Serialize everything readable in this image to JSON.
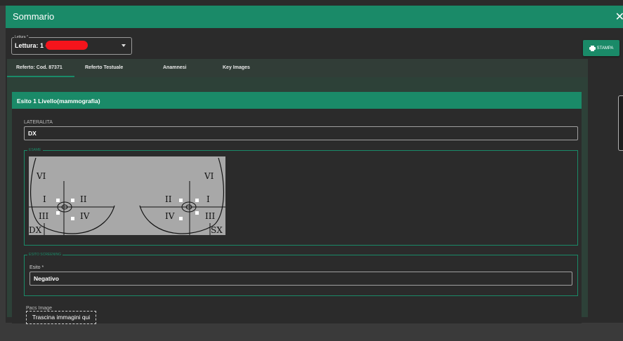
{
  "dialog": {
    "title": "Sommario",
    "close_icon": "close-icon"
  },
  "lettura": {
    "label": "Lettura *",
    "value": "Lettura: 1 -"
  },
  "toolbar": {
    "print_label": "STAMPA"
  },
  "tabs": [
    {
      "label": "Referto: Cod. 87371",
      "active": true
    },
    {
      "label": "Referto Testuale"
    },
    {
      "label": "Anamnesi"
    },
    {
      "label": "Key Images"
    }
  ],
  "card": {
    "title": "Esito 1 Livello(mammografia)",
    "lateralita": {
      "label": "LATERALITA",
      "value": "DX"
    },
    "esame": {
      "legend": "ESAME",
      "diagram": {
        "left": {
          "VI": "VI",
          "I": "I",
          "II": "II",
          "III": "III",
          "IV": "IV",
          "side": "DX"
        },
        "right": {
          "VI": "VI",
          "I": "I",
          "II": "II",
          "III": "III",
          "IV": "IV",
          "side": "SX"
        }
      }
    },
    "esito_screening": {
      "legend": "ESITO SCREENING",
      "label": "Esito *",
      "value": "Negativo"
    },
    "pacs": {
      "label": "Pacs Image",
      "drop_text": "Trascina immagini qui"
    }
  },
  "colors": {
    "accent": "#1a8a68",
    "background": "#2b2b2b",
    "redaction": "#f5141c"
  }
}
